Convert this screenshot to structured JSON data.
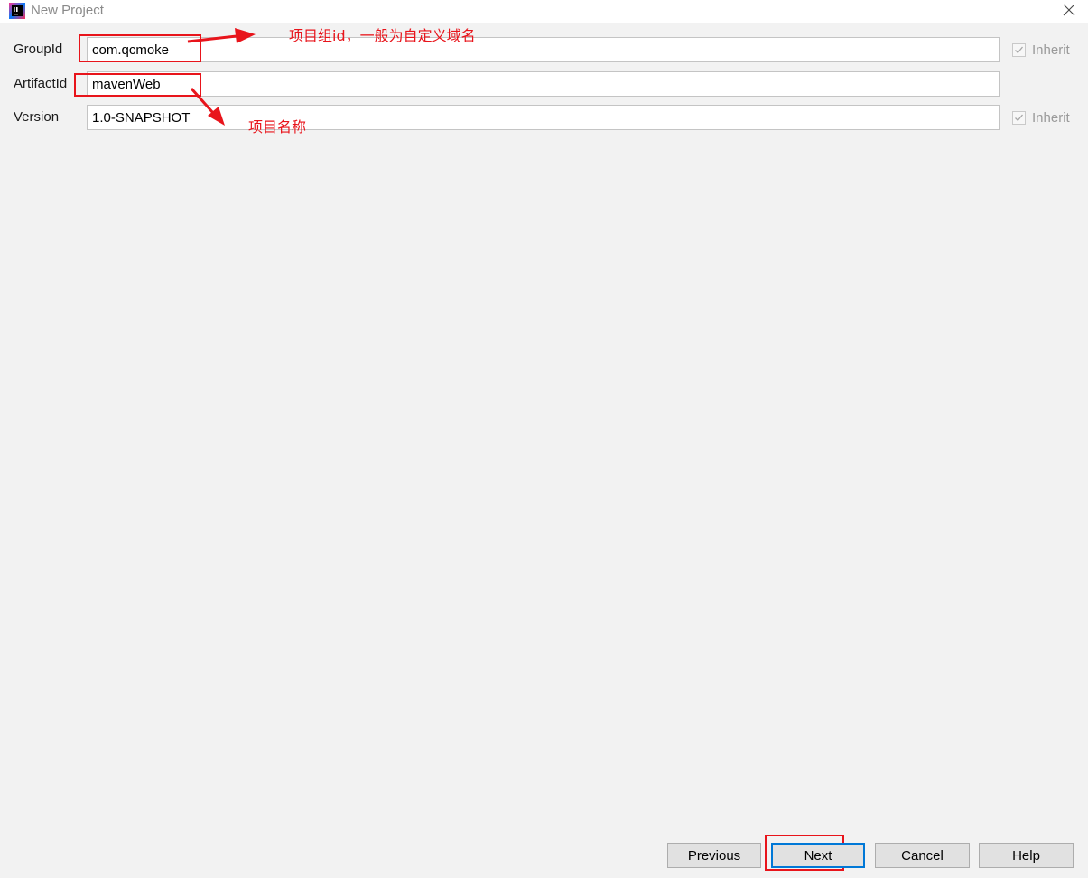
{
  "window": {
    "title": "New Project",
    "icon": "intellij-idea-icon",
    "close_icon": "close-icon"
  },
  "fields": [
    {
      "label": "GroupId",
      "value": "com.qcmoke",
      "inherit_label": "Inherit",
      "inherit_checked": true
    },
    {
      "label": "ArtifactId",
      "value": "mavenWeb"
    },
    {
      "label": "Version",
      "value": "1.0-SNAPSHOT",
      "inherit_label": "Inherit",
      "inherit_checked": true
    }
  ],
  "annotations": {
    "groupid_note": "项目组id，一般为自定义域名",
    "artifactid_note": "项目名称",
    "color": "#e8141b"
  },
  "buttons": {
    "previous": "Previous",
    "next": "Next",
    "cancel": "Cancel",
    "help": "Help"
  },
  "colors": {
    "background": "#f2f2f2",
    "default_button_border": "#0078d7"
  }
}
